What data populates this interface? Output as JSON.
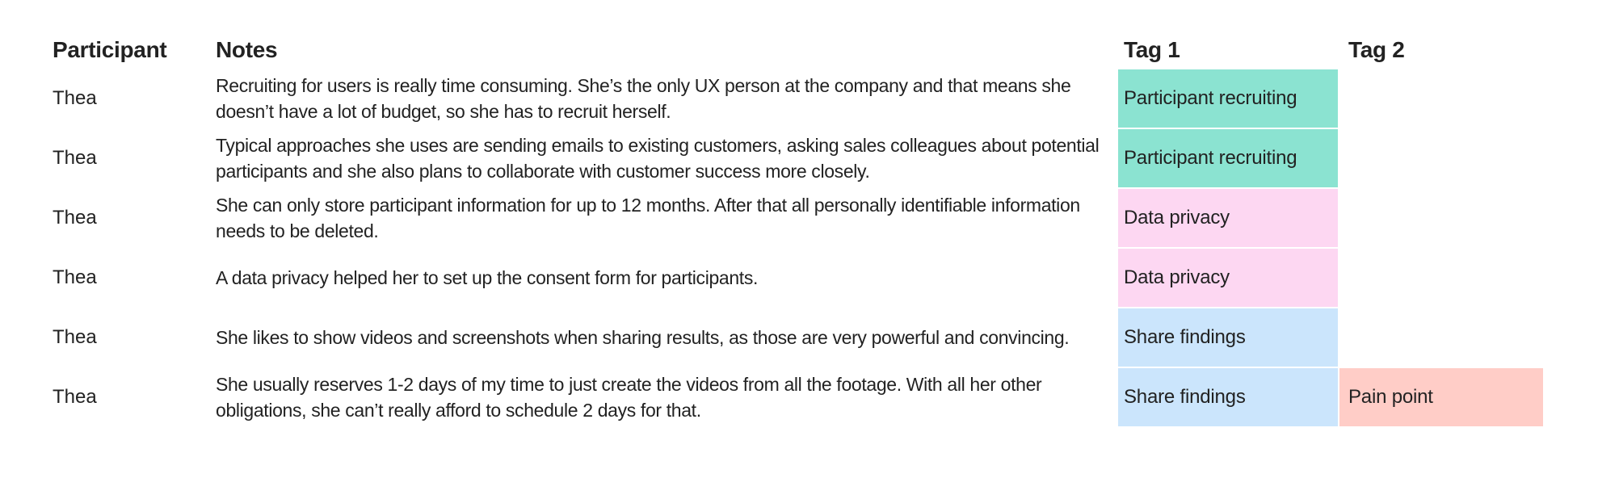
{
  "headers": {
    "participant": "Participant",
    "notes": "Notes",
    "tag1": "Tag 1",
    "tag2": "Tag 2"
  },
  "tag_colors": {
    "Participant recruiting": "#8BE3D1",
    "Data privacy": "#FDD7F2",
    "Share findings": "#CBE5FC",
    "Pain point": "#FFCDC7"
  },
  "rows": [
    {
      "participant": "Thea",
      "notes": "Recruiting for users is really time consuming. She’s the only UX person at the company and that means she doesn’t have a lot of budget, so she has to recruit herself.",
      "tag1": "Participant recruiting",
      "tag2": ""
    },
    {
      "participant": "Thea",
      "notes": "Typical approaches she uses are sending emails to existing customers, asking sales colleagues about potential participants and she also plans to collaborate with customer success more closely.",
      "tag1": "Participant recruiting",
      "tag2": ""
    },
    {
      "participant": "Thea",
      "notes": "She can only store participant information for up to 12 months. After that all personally identifiable information needs to be deleted.",
      "tag1": "Data privacy",
      "tag2": ""
    },
    {
      "participant": "Thea",
      "notes": "A data privacy helped her to set up the consent form for participants.",
      "tag1": "Data privacy",
      "tag2": ""
    },
    {
      "participant": "Thea",
      "notes": "She likes to show videos and screenshots when sharing results, as those are very powerful and convincing.",
      "tag1": "Share findings",
      "tag2": ""
    },
    {
      "participant": "Thea",
      "notes": "She usually reserves 1-2 days of my time to just create the videos from all the footage. With all her other obligations, she can’t really afford to schedule 2 days for that.",
      "tag1": "Share findings",
      "tag2": "Pain point"
    }
  ]
}
